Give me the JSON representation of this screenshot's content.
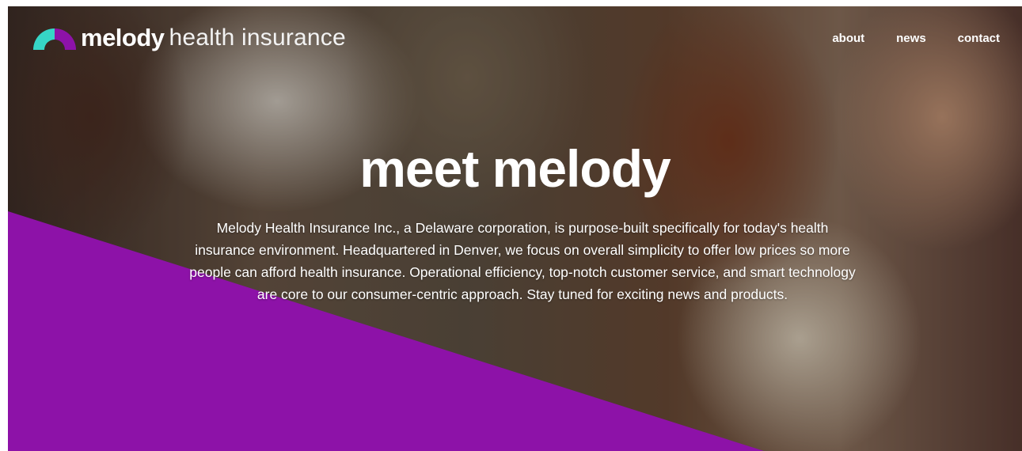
{
  "brand": {
    "name": "melody",
    "subtitle": "health insurance",
    "logo_icon": "melody-arc-logo-icon",
    "colors": {
      "teal": "#36d6c6",
      "purple": "#8d12a8"
    }
  },
  "nav": {
    "items": [
      {
        "label": "about"
      },
      {
        "label": "news"
      },
      {
        "label": "contact"
      }
    ]
  },
  "hero": {
    "title": "meet melody",
    "description": "Melody Health Insurance Inc., a Delaware corporation, is purpose-built specifically for today's health insurance environment. Headquartered in Denver, we focus on overall simplicity to offer low prices so more people can afford health insurance. Operational efficiency, top-notch customer service, and smart technology are core to our consumer-centric approach. Stay tuned for exciting news and products.",
    "accent_color": "#8d12a8"
  }
}
